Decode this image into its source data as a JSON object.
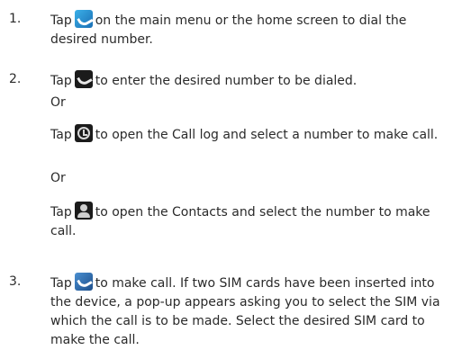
{
  "steps": [
    {
      "number": "1.",
      "text_before": "Tap",
      "icon": "phone-app-icon",
      "text_after": "on the main menu or the home screen to dial the desired number."
    },
    {
      "number": "2.",
      "lines": [
        {
          "text_before": "Tap",
          "icon": "dialer-icon",
          "text_after": "to enter the desired number to be dialed."
        },
        {
          "text": "Or"
        },
        {
          "text_before": "Tap",
          "icon": "call-log-icon",
          "text_after": "to open the Call log and select a number to make call."
        },
        {
          "text": "Or"
        },
        {
          "text_before": "Tap",
          "icon": "contacts-icon",
          "text_after": "to open the Contacts and select the number to make call."
        }
      ]
    },
    {
      "number": "3.",
      "text_before": "Tap",
      "icon": "call-icon",
      "text_after": "to make call. If two SIM cards have been inserted into the device, a pop-up appears asking you to select the SIM via which the call is to be made. Select the desired SIM card to make the call."
    }
  ]
}
